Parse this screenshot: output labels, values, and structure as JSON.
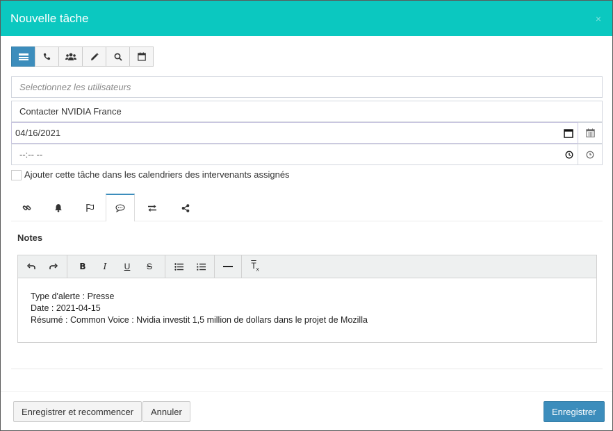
{
  "modal": {
    "title": "Nouvelle tâche",
    "close_glyph": "×"
  },
  "type_toolbar": [
    {
      "name": "task-type-general",
      "icon": "list-icon",
      "active": true
    },
    {
      "name": "task-type-call",
      "icon": "phone-icon"
    },
    {
      "name": "task-type-meeting",
      "icon": "users-icon"
    },
    {
      "name": "task-type-note",
      "icon": "pencil-icon"
    },
    {
      "name": "task-type-search",
      "icon": "search-icon"
    },
    {
      "name": "task-type-calendar",
      "icon": "calendar-icon"
    }
  ],
  "form": {
    "users_placeholder": "Selectionnez les utilisateurs",
    "subject_value": "Contacter NVIDIA France",
    "date_value": "04/16/2021",
    "time_value": "--:-- --",
    "add_to_calendar_label": "Ajouter cette tâche dans les calendriers des intervenants assignés"
  },
  "tabs": [
    {
      "name": "tab-links",
      "icon": "link-icon"
    },
    {
      "name": "tab-alerts",
      "icon": "bell-icon"
    },
    {
      "name": "tab-flag",
      "icon": "flag-icon"
    },
    {
      "name": "tab-notes",
      "icon": "comment-icon",
      "active": true
    },
    {
      "name": "tab-transfer",
      "icon": "exchange-icon"
    },
    {
      "name": "tab-share",
      "icon": "share-icon"
    }
  ],
  "notes": {
    "label": "Notes",
    "lines": [
      "Type d'alerte : Presse",
      "Date : 2021-04-15",
      "Résumé : Common Voice : Nvidia investit 1,5 million de dollars dans le projet de Mozilla"
    ]
  },
  "editor_toolbar": {
    "bold": "B",
    "italic": "I",
    "underline": "U",
    "strike": "S",
    "clear_format": "T"
  },
  "footer": {
    "save_and_new": "Enregistrer et recommencer",
    "cancel": "Annuler",
    "save": "Enregistrer"
  },
  "colors": {
    "header": "#0bc8c0",
    "primary": "#3c8dbc"
  }
}
